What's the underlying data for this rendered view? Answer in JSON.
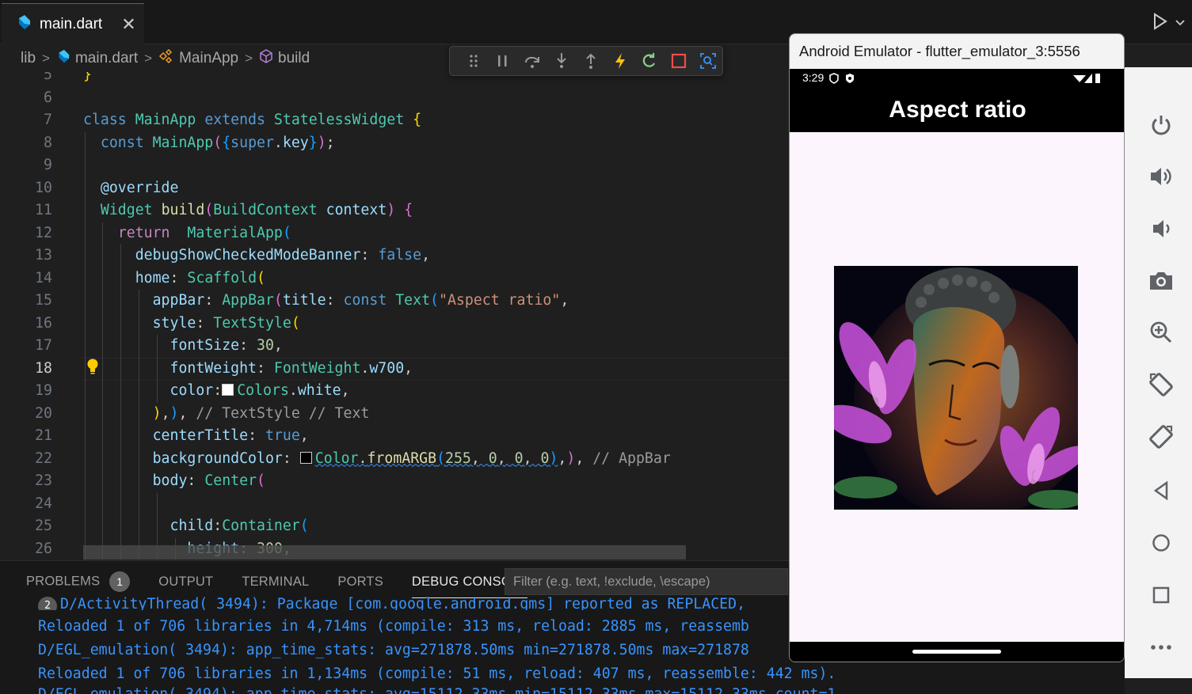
{
  "tab": {
    "title": "main.dart",
    "close": "✕"
  },
  "breadcrumb": {
    "items": [
      "lib",
      "main.dart",
      "MainApp",
      "build"
    ]
  },
  "editor": {
    "active_line": "18",
    "line_numbers": [
      "5",
      "6",
      "7",
      "8",
      "9",
      "10",
      "11",
      "12",
      "13",
      "14",
      "15",
      "16",
      "17",
      "18",
      "19",
      "20",
      "21",
      "22",
      "23",
      "24",
      "25",
      "26"
    ]
  },
  "panel": {
    "tabs": [
      "PROBLEMS",
      "OUTPUT",
      "TERMINAL",
      "PORTS",
      "DEBUG CONSOLE"
    ],
    "problems_count": "1",
    "filter_placeholder": "Filter (e.g. text, !exclude, \\escape)",
    "console_lines": [
      "D/ActivityThread( 3494): Package [com.google.android.gms] reported as REPLACED,",
      "Reloaded 1 of 706 libraries in 4,714ms (compile: 313 ms, reload: 2885 ms, reassemb",
      "D/EGL_emulation( 3494): app_time_stats: avg=271878.50ms min=271878.50ms max=271878",
      "Reloaded 1 of 706 libraries in 1,134ms (compile: 51 ms, reload: 407 ms, reassemble: 442 ms).",
      "D/EGL_emulation( 3494): app_time_stats: avg=15112.33ms min=15112.33ms max=15112.33ms count=1"
    ],
    "console_badge": "2"
  },
  "emulator": {
    "window_title": "Android Emulator - flutter_emulator_3:5556",
    "status_time": "3:29",
    "app_title": "Aspect ratio"
  },
  "colors": {
    "accent": "#0078d4",
    "console_text": "#3794ff",
    "app_background": "#fcf5fd"
  },
  "icons": {
    "debug_toolbar": [
      "drag-handle-icon",
      "pause-icon",
      "step-over-icon",
      "step-into-icon",
      "step-out-icon",
      "hot-reload-icon",
      "hot-restart-icon",
      "stop-icon",
      "inspect-widget-icon"
    ],
    "emulator_side": [
      "power-icon",
      "volume-up-icon",
      "volume-down-icon",
      "camera-icon",
      "zoom-icon",
      "rotate-left-icon",
      "rotate-right-icon",
      "back-icon",
      "home-icon",
      "overview-icon",
      "more-icon"
    ]
  }
}
